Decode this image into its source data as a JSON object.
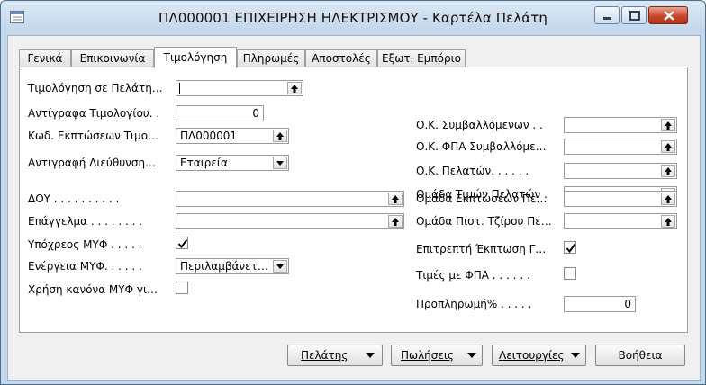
{
  "window": {
    "title": "ΠΛ000001 ΕΠΙΧΕΙΡΗΣΗ ΗΛΕΚΤΡΙΣΜΟΥ - Καρτέλα Πελάτη"
  },
  "tabs": [
    {
      "label": "Γενικά"
    },
    {
      "label": "Επικοινωνία"
    },
    {
      "label": "Τιμολόγηση",
      "active": true
    },
    {
      "label": "Πληρωμές"
    },
    {
      "label": "Αποστολές"
    },
    {
      "label": "Εξωτ. Εμπόριο"
    }
  ],
  "left": {
    "invoicing_to_customer": {
      "label": "Τιμολόγηση σε Πελάτη…",
      "value": ""
    },
    "invoice_copies": {
      "label": "Αντίγραφα Τιμολογίου. .",
      "value": "0"
    },
    "invoice_discount_code": {
      "label": "Κωδ. Εκπτώσεων Τιμο…",
      "value": "ΠΛ000001"
    },
    "copy_address": {
      "label": "Αντιγραφή Διεύθυνση…",
      "value": "Εταιρεία"
    },
    "tax_office": {
      "label": "ΔΟΥ . . . . . . . . . .",
      "value": ""
    },
    "profession": {
      "label": "Επάγγελμα . . . . . . . .",
      "value": ""
    },
    "myf_required": {
      "label": "Υπόχρεος ΜΥΦ . . . . .",
      "checked": true
    },
    "myf_action": {
      "label": "Ενέργεια ΜΥΦ. . . . . .",
      "value": "Περιλαμβάνετ…"
    },
    "myf_rule": {
      "label": "Χρήση κανόνα ΜΥΦ γι…",
      "checked": false
    }
  },
  "right": {
    "gen_bus_posting": {
      "label": "Ο.Κ. Συμβαλλόμενων . .",
      "value": ""
    },
    "vat_bus_posting": {
      "label": "Ο.Κ. ΦΠΑ Συμβαλλόμε…",
      "value": ""
    },
    "customer_posting": {
      "label": "Ο.Κ. Πελατών. . . . . .",
      "value": ""
    },
    "customer_price_group": {
      "label": "Ομάδα Τιμών Πελατών  .",
      "value": ""
    },
    "customer_disc_group": {
      "label": "Ομάδα Εκπτώσεων Πε…",
      "value": ""
    },
    "credit_group": {
      "label": "Ομάδα Πιστ. Τζίρου Πε…",
      "value": ""
    },
    "allow_inv_disc": {
      "label": "Επιτρεπτή Έκπτωση Γ…",
      "checked": true
    },
    "prices_incl_vat": {
      "label": "Τιμές με ΦΠΑ . . . . . .",
      "checked": false
    },
    "prepayment_pct": {
      "label": "Προπληρωμή% . . . . .",
      "value": "0"
    }
  },
  "buttons": {
    "customer": "Πελάτης",
    "sales": "Πωλήσεις",
    "functions": "Λειτουργίες",
    "help": "Βοήθεια"
  }
}
